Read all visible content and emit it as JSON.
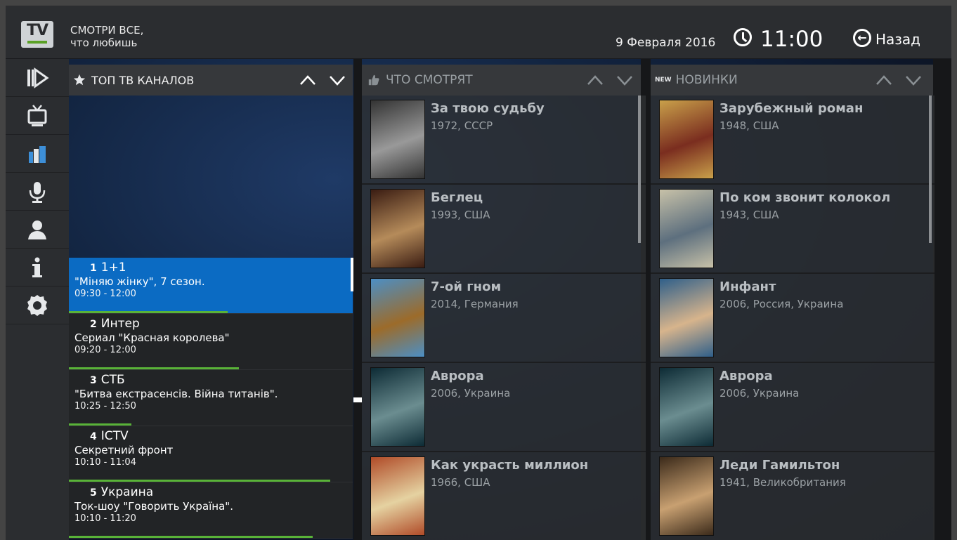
{
  "header": {
    "logo_text": "TV",
    "tagline_line1": "СМОТРИ ВСЕ,",
    "tagline_line2": "что любишь",
    "date": "9 Февраля 2016",
    "time": "11:00",
    "back_label": "Назад"
  },
  "sidebar": {
    "items": [
      {
        "icon": "play-forward-icon"
      },
      {
        "icon": "tv-icon"
      },
      {
        "icon": "library-icon"
      },
      {
        "icon": "microphone-icon"
      },
      {
        "icon": "user-icon"
      },
      {
        "icon": "info-icon"
      },
      {
        "icon": "gear-icon"
      }
    ]
  },
  "panels": {
    "top_channels_title": "ТОП ТВ КАНАЛОВ",
    "watching_title": "ЧТО СМОТРЯТ",
    "new_title": "НОВИНКИ",
    "new_badge": "NEW"
  },
  "channels": [
    {
      "num": "1",
      "name": "1+1",
      "show": "\"Міняю жінку\", 7 сезон.",
      "hours": "09:30 - 12:00",
      "progress": 0.56
    },
    {
      "num": "2",
      "name": "Интер",
      "show": "Сериал \"Красная королева\"",
      "hours": "09:20 - 12:00",
      "progress": 0.6
    },
    {
      "num": "3",
      "name": "СТБ",
      "show": "\"Битва екстрасенсів. Війна титанів\".",
      "hours": "10:25 - 12:50",
      "progress": 0.22
    },
    {
      "num": "4",
      "name": "ICTV",
      "show": "Секретний фронт",
      "hours": "10:10 - 11:04",
      "progress": 0.92
    },
    {
      "num": "5",
      "name": "Украина",
      "show": "Ток-шоу \"Говорить Україна\".",
      "hours": "10:10 - 11:20",
      "progress": 0.86
    }
  ],
  "watching": [
    {
      "title": "За твою судьбу",
      "meta": "1972, СССР",
      "poster_colors": [
        "#333",
        "#999"
      ]
    },
    {
      "title": "Беглец",
      "meta": "1993, США",
      "poster_colors": [
        "#3a1c12",
        "#b58b5a"
      ]
    },
    {
      "title": "7-ой гном",
      "meta": "2014, Германия",
      "poster_colors": [
        "#4c8fc5",
        "#9c6b2a"
      ]
    },
    {
      "title": "Аврора",
      "meta": "2006, Украина",
      "poster_colors": [
        "#0d2b35",
        "#6b8d90"
      ]
    },
    {
      "title": "Как украсть миллион",
      "meta": "1966, США",
      "poster_colors": [
        "#b04b28",
        "#e5d2a1"
      ]
    }
  ],
  "new_releases": [
    {
      "title": "Зарубежный роман",
      "meta": "1948, США",
      "poster_colors": [
        "#c9a04a",
        "#7a2d1f"
      ]
    },
    {
      "title": "По ком звонит колокол",
      "meta": "1943, США",
      "poster_colors": [
        "#c7c1a8",
        "#5d6f7e"
      ]
    },
    {
      "title": "Инфант",
      "meta": "2006, Россия, Украина",
      "poster_colors": [
        "#2f5f8a",
        "#d7b48c"
      ]
    },
    {
      "title": "Аврора",
      "meta": "2006, Украина",
      "poster_colors": [
        "#0d2b35",
        "#6b8d90"
      ]
    },
    {
      "title": "Леди Гамильтон",
      "meta": "1941, Великобритания",
      "poster_colors": [
        "#3b2a1a",
        "#c8a071"
      ]
    }
  ]
}
